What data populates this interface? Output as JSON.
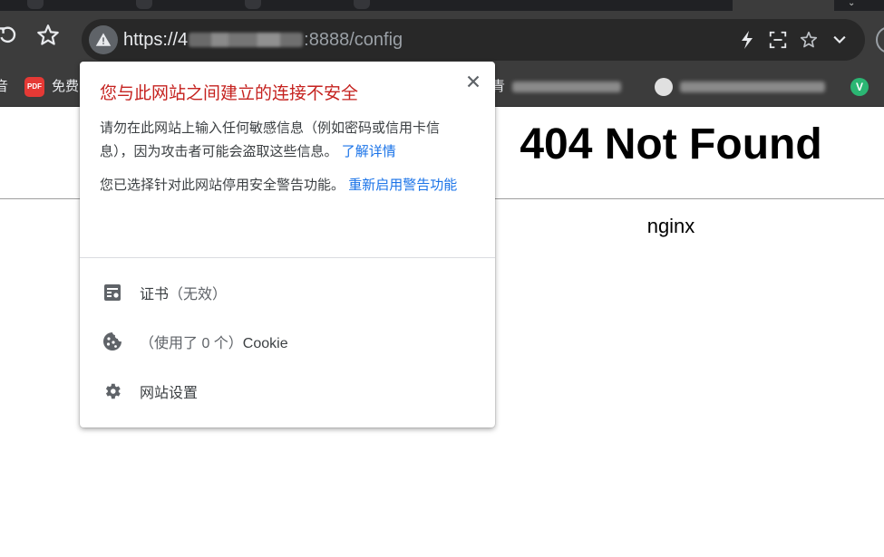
{
  "browser": {
    "url_scheme": "https://",
    "url_host_visible": "4",
    "url_rest": ":8888/config",
    "bookmarks": [
      {
        "label": "音"
      },
      {
        "label": "免费"
      },
      {
        "label": "青"
      }
    ],
    "pdf_badge": "PDF",
    "v_badge": "V"
  },
  "page": {
    "title": "404 Not Found",
    "footer": "nginx"
  },
  "popup": {
    "heading": "您与此网站之间建立的连接不安全",
    "warning_text": "请勿在此网站上输入任何敏感信息（例如密码或信用卡信息），因为攻击者可能会盗取这些信息。",
    "learn_more_link": "了解详情",
    "disabled_text": "您已选择针对此网站停用安全警告功能。",
    "reenable_link": "重新启用警告功能",
    "close_glyph": "✕",
    "certificate_label": "证书",
    "certificate_status": "（无效）",
    "cookie_count": "（使用了 0 个）",
    "cookie_label": "Cookie",
    "site_settings_label": "网站设置"
  },
  "colors": {
    "heading_red": "#c5221f",
    "link_blue": "#1a73e8",
    "chrome_dark": "#3c3c3c"
  }
}
